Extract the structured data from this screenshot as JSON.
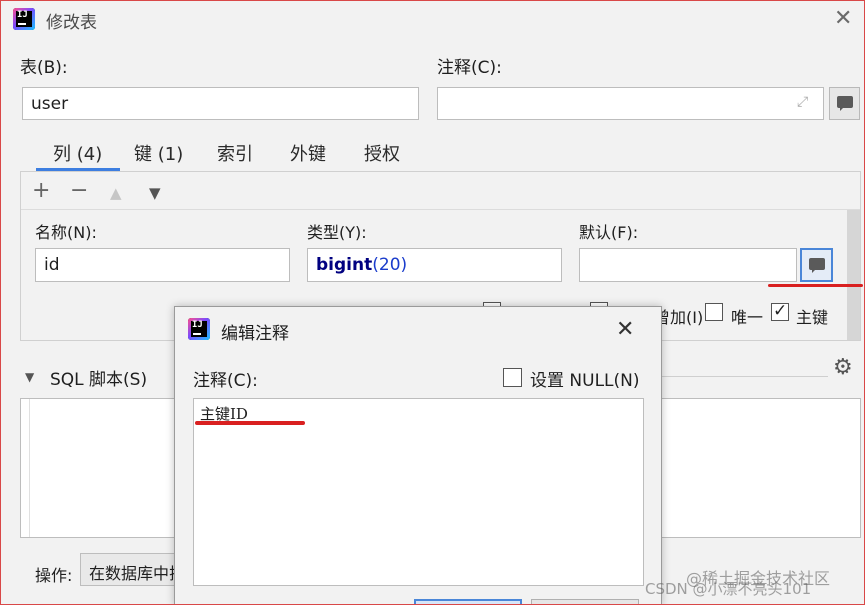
{
  "window": {
    "title": "修改表",
    "close_glyph": "✕"
  },
  "app_icon": {
    "name": "intellij-icon",
    "text": "IJ"
  },
  "table": {
    "label": "表(B):",
    "value": "user"
  },
  "comment": {
    "label": "注释(C):",
    "value": ""
  },
  "tabs": [
    {
      "label": "列 (4)",
      "active": true
    },
    {
      "label": "键 (1)"
    },
    {
      "label": "索引"
    },
    {
      "label": "外键"
    },
    {
      "label": "授权"
    }
  ],
  "toolbar": {
    "add": "+",
    "remove": "−",
    "up": "▲",
    "down": "▼"
  },
  "column": {
    "name_label": "名称(N):",
    "name_value": "id",
    "type_label": "类型(Y):",
    "type_keyword": "bigint",
    "type_open": "(",
    "type_num": "20",
    "type_close": ")",
    "default_label": "默认(F):",
    "default_value": ""
  },
  "checkboxes": {
    "autoinc_partial": "曾加(I)",
    "unique": "唯一",
    "primary_key": "主键",
    "primary_key_checked": true
  },
  "sql": {
    "toggle": "▼",
    "label": "SQL 脚本(S)",
    "gear": "⚙"
  },
  "ops": {
    "label": "操作:",
    "value_partial": "在数据库中拉"
  },
  "dialog": {
    "title": "编辑注释",
    "close_glyph": "✕",
    "comment_label": "注释(C):",
    "null_label": "设置 NULL(N)",
    "comment_text": "主键ID"
  },
  "watermark": {
    "line1": "@稀土掘金技术社区",
    "line2": "CSDN @小漂不亮头101"
  },
  "colors": {
    "accent": "#3d7ee0",
    "annotation_red": "#d92020",
    "keyword": "#000080",
    "number": "#1a3ccc"
  }
}
